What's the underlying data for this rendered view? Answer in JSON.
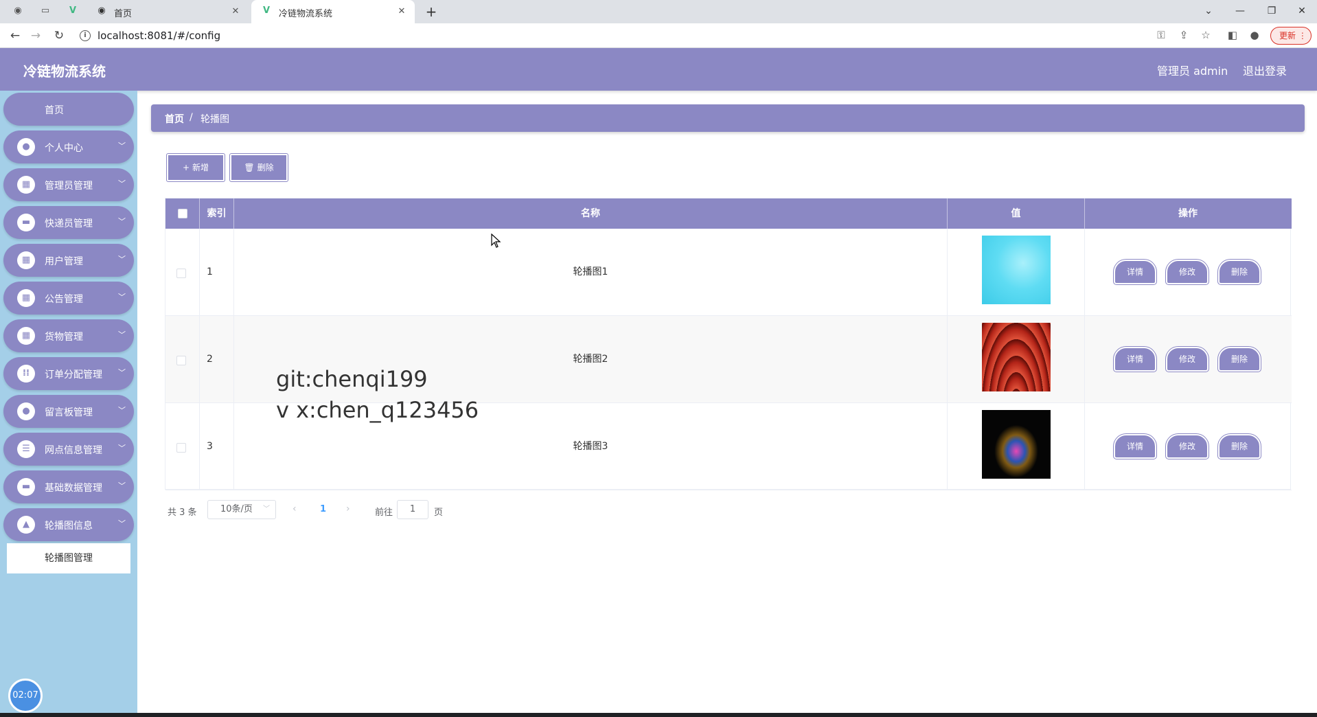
{
  "browser": {
    "tabs": [
      {
        "title": "首页",
        "active": false
      },
      {
        "title": "冷链物流系统",
        "active": true
      }
    ],
    "url": "localhost:8081/#/config",
    "update_label": "更新"
  },
  "app": {
    "title": "冷链物流系统",
    "admin_label": "管理员 admin",
    "logout_label": "退出登录"
  },
  "sidebar": {
    "home": "首页",
    "items": [
      {
        "label": "个人中心",
        "icon": "user-icon"
      },
      {
        "label": "管理员管理",
        "icon": "grid-icon"
      },
      {
        "label": "快递员管理",
        "icon": "monitor-icon"
      },
      {
        "label": "用户管理",
        "icon": "grid-icon"
      },
      {
        "label": "公告管理",
        "icon": "grid-icon"
      },
      {
        "label": "货物管理",
        "icon": "grid-icon"
      },
      {
        "label": "订单分配管理",
        "icon": "apps-icon"
      },
      {
        "label": "留言板管理",
        "icon": "user-icon"
      },
      {
        "label": "网点信息管理",
        "icon": "sliders-icon"
      },
      {
        "label": "基础数据管理",
        "icon": "monitor-icon"
      },
      {
        "label": "轮播图信息",
        "icon": "image-icon"
      }
    ],
    "submenu": "轮播图管理",
    "clock": "02:07"
  },
  "breadcrumb": {
    "home": "首页",
    "separator": "/",
    "current": "轮播图"
  },
  "actions": {
    "add_label": "新增",
    "delete_label": "删除"
  },
  "table": {
    "columns": [
      "索引",
      "名称",
      "值",
      "操作"
    ],
    "rows": [
      {
        "index": "1",
        "name": "轮播图1"
      },
      {
        "index": "2",
        "name": "轮播图2"
      },
      {
        "index": "3",
        "name": "轮播图3"
      }
    ],
    "ops": {
      "detail": "详情",
      "edit": "修改",
      "delete": "删除"
    }
  },
  "pager": {
    "total": "共 3 条",
    "page_size": "10条/页",
    "current_page": "1",
    "goto_label": "前往",
    "goto_value": "1",
    "goto_unit": "页"
  },
  "watermark": {
    "line1": "git:chenqi199",
    "line2": "v x:chen_q123456"
  }
}
